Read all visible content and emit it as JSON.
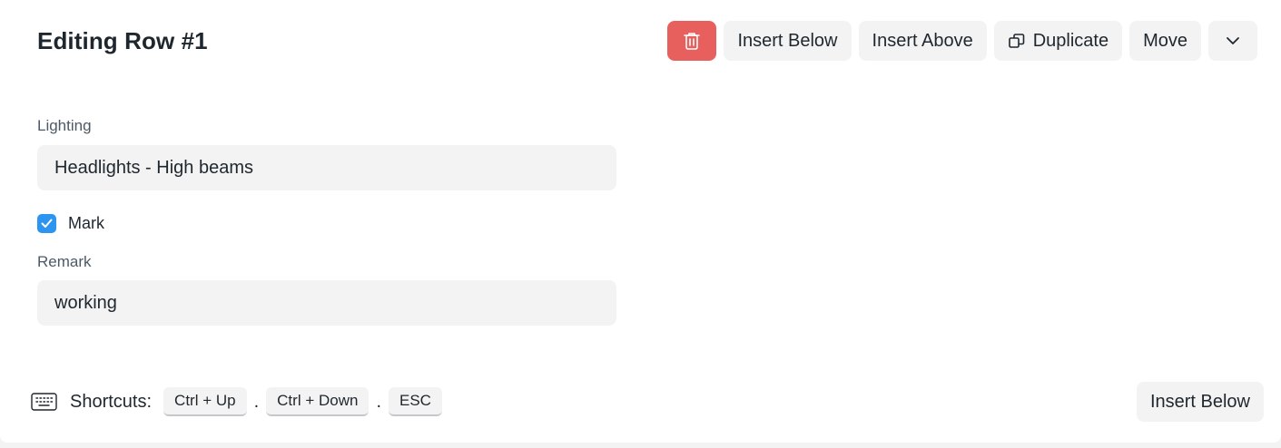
{
  "header": {
    "title": "Editing Row #1"
  },
  "toolbar": {
    "delete_icon": "trash-icon",
    "insert_below_label": "Insert Below",
    "insert_above_label": "Insert Above",
    "duplicate_label": "Duplicate",
    "duplicate_icon": "duplicate-icon",
    "move_label": "Move",
    "more_icon": "chevron-down-icon",
    "danger_color": "#e8605e"
  },
  "form": {
    "lighting": {
      "label": "Lighting",
      "value": "Headlights - High beams"
    },
    "mark": {
      "label": "Mark",
      "checked": true,
      "check_color": "#2d95f0"
    },
    "remark": {
      "label": "Remark",
      "value": "working"
    }
  },
  "footer": {
    "keyboard_icon": "keyboard-icon",
    "shortcuts_label": "Shortcuts:",
    "keys": [
      "Ctrl + Up",
      "Ctrl + Down",
      "ESC"
    ],
    "separator": ".",
    "insert_below_label": "Insert Below"
  }
}
